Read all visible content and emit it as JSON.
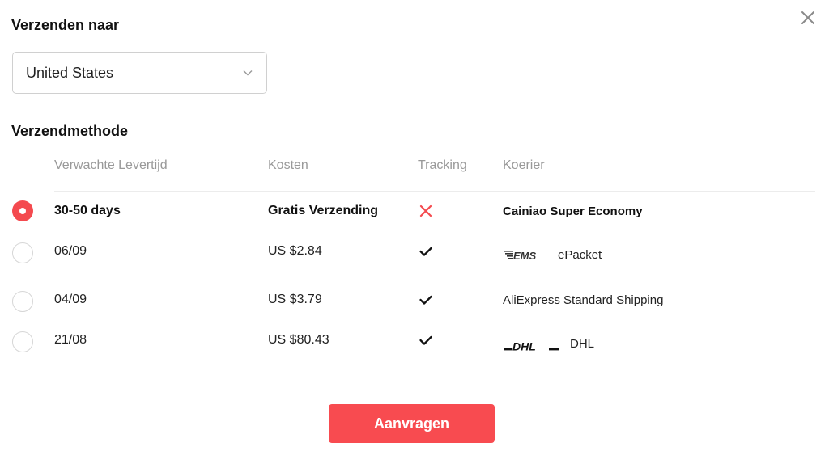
{
  "dialog": {
    "close_icon": "close-icon",
    "ship_to": {
      "label": "Verzenden naar",
      "selected_country": "United States",
      "chevron_icon": "chevron-down-icon"
    },
    "shipping_method": {
      "label": "Verzendmethode",
      "columns": [
        "Verwachte Levertijd",
        "Kosten",
        "Tracking",
        "Koerier"
      ],
      "rows": [
        {
          "selected": true,
          "delivery": "30-50 days",
          "cost": "Gratis Verzending",
          "tracking": false,
          "tracking_icon": "cross-icon",
          "courier_logo": "",
          "courier": "Cainiao Super Economy"
        },
        {
          "selected": false,
          "delivery": "06/09",
          "cost": "US $2.84",
          "tracking": true,
          "tracking_icon": "check-icon",
          "courier_logo": "EMS",
          "courier": "ePacket"
        },
        {
          "selected": false,
          "delivery": "04/09",
          "cost": "US $3.79",
          "tracking": true,
          "tracking_icon": "check-icon",
          "courier_logo": "",
          "courier": "AliExpress Standard Shipping"
        },
        {
          "selected": false,
          "delivery": "21/08",
          "cost": "US $80.43",
          "tracking": true,
          "tracking_icon": "check-icon",
          "courier_logo": "DHL",
          "courier": "DHL"
        }
      ]
    },
    "submit_label": "Aanvragen",
    "colors": {
      "accent": "#f84b50",
      "muted": "#999999",
      "cross": "#f44a4f"
    }
  }
}
